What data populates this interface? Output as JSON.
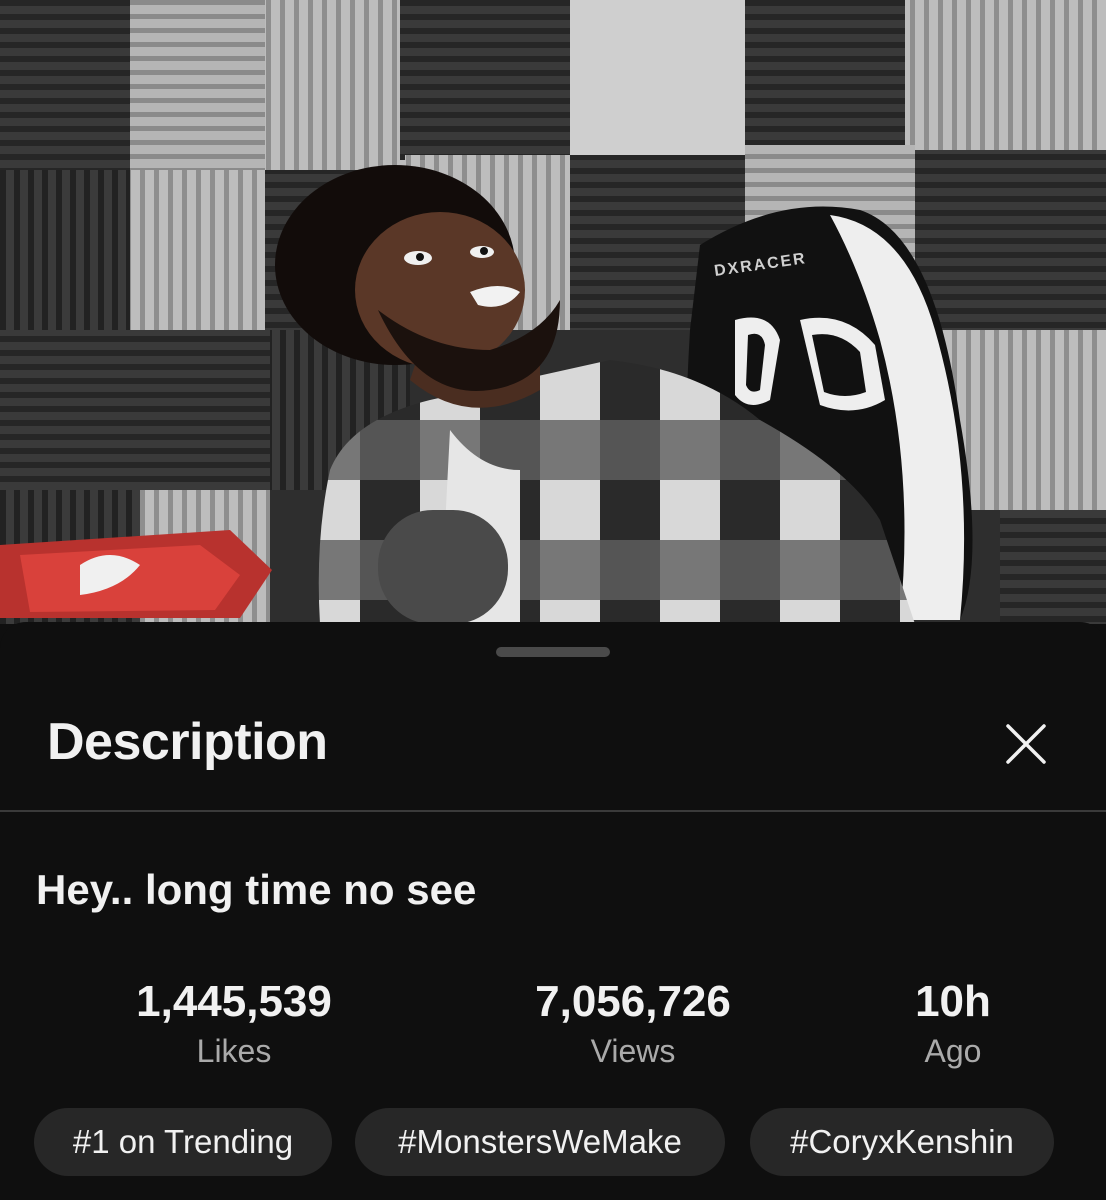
{
  "video": {
    "chair_brand": "DXRACER"
  },
  "sheet": {
    "title": "Description",
    "close_icon": "close-icon"
  },
  "description": {
    "video_title": "Hey.. long time no see",
    "stats": [
      {
        "value": "1,445,539",
        "label": "Likes"
      },
      {
        "value": "7,056,726",
        "label": "Views"
      },
      {
        "value": "10h",
        "label": "Ago"
      }
    ],
    "chips": [
      {
        "label": "#1 on Trending"
      },
      {
        "label": "#MonstersWeMake"
      },
      {
        "label": "#CoryxKenshin"
      }
    ]
  },
  "colors": {
    "background": "#0f0f0f",
    "chip_background": "#272727",
    "secondary_text": "#aaaaaa",
    "primary_text": "#f1f1f1"
  }
}
